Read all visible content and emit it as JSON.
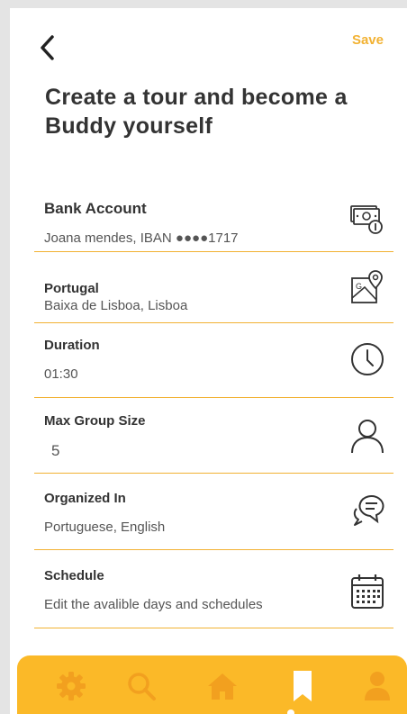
{
  "header": {
    "back_icon": "chevron-left-icon",
    "save_label": "Save",
    "title": "Create a tour and become a Buddy yourself"
  },
  "colors": {
    "accent": "#f2b233",
    "tabbar": "#fbb928",
    "tab_icon": "#f2a01f",
    "text": "#333333"
  },
  "fields": {
    "bank": {
      "label": "Bank Account",
      "value": "Joana mendes, IBAN ●●●●1717",
      "icon": "money-icon"
    },
    "location": {
      "label": "Portugal",
      "value": "Baixa de Lisboa, Lisboa",
      "icon": "map-pin-icon"
    },
    "duration": {
      "label": "Duration",
      "value": "01:30",
      "icon": "clock-icon"
    },
    "group_size": {
      "label": "Max Group Size",
      "value": "5",
      "icon": "person-icon"
    },
    "languages": {
      "label": "Organized In",
      "value": "Portuguese, English",
      "icon": "chat-icon"
    },
    "schedule": {
      "label": "Schedule",
      "value": "Edit the avalible days and schedules",
      "icon": "calendar-icon"
    }
  },
  "tabbar": {
    "items": [
      {
        "icon": "gear-icon",
        "active": false
      },
      {
        "icon": "search-icon",
        "active": false
      },
      {
        "icon": "home-icon",
        "active": false
      },
      {
        "icon": "bookmark-icon",
        "active": true
      },
      {
        "icon": "user-icon",
        "active": false
      }
    ]
  }
}
